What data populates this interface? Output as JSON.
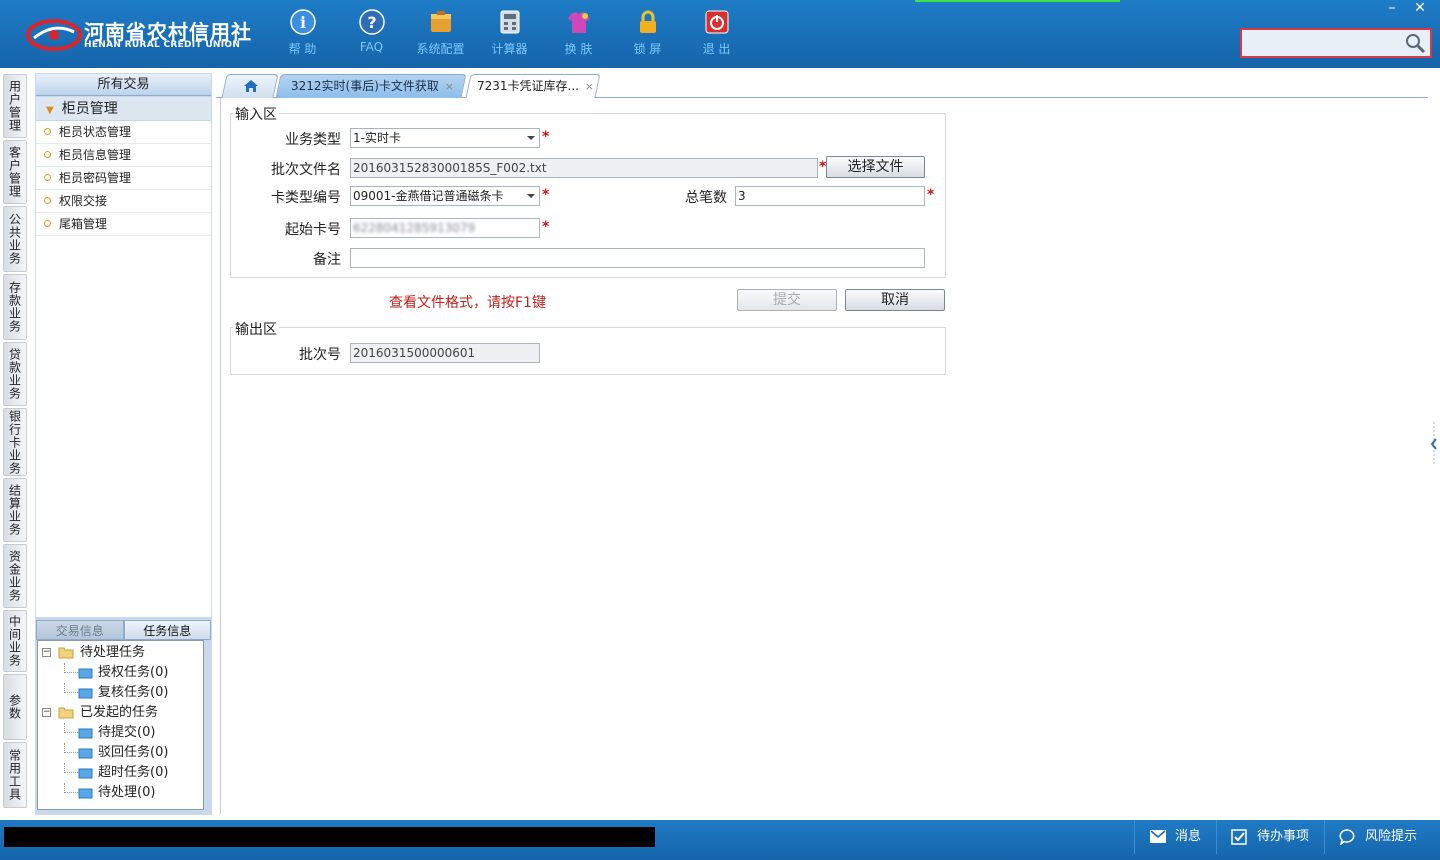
{
  "header": {
    "logo_cn": "河南省农村信用社",
    "logo_en": "HENAN RURAL CREDIT UNION",
    "toolbar": [
      {
        "label": "帮 助",
        "icon": "help-icon"
      },
      {
        "label": "FAQ",
        "icon": "faq-icon"
      },
      {
        "label": "系统配置",
        "icon": "system-config-icon"
      },
      {
        "label": "计算器",
        "icon": "calculator-icon"
      },
      {
        "label": "换 肤",
        "icon": "skin-icon"
      },
      {
        "label": "锁 屏",
        "icon": "lock-icon"
      },
      {
        "label": "退 出",
        "icon": "power-icon"
      }
    ],
    "window_buttons": {
      "minimize": "–",
      "close": "✕"
    },
    "search": {
      "value": ""
    }
  },
  "side_tabs": [
    "用户管理",
    "客户管理",
    "公共业务",
    "存款业务",
    "贷款业务",
    "银行卡业务",
    "结算业务",
    "资金业务",
    "中间业务",
    "参数",
    "常用工具"
  ],
  "left_panel": {
    "title": "所有交易",
    "group": "柜员管理",
    "items": [
      "柜员状态管理",
      "柜员信息管理",
      "柜员密码管理",
      "权限交接",
      "尾箱管理"
    ],
    "tabs": {
      "trans_info": "交易信息",
      "task_info": "任务信息"
    },
    "tree": {
      "pending": "待处理任务",
      "pending_children": [
        "授权任务(0)",
        "复核任务(0)"
      ],
      "initiated": "已发起的任务",
      "initiated_children": [
        "待提交(0)",
        "驳回任务(0)",
        "超时任务(0)",
        "待处理(0)"
      ]
    }
  },
  "content_tabs": {
    "active": "3212实时(事后)卡文件获取",
    "second": "7231卡凭证库存...",
    "close": "×"
  },
  "form": {
    "input_section": "输入区",
    "business_type_label": "业务类型",
    "business_type_value": "1-实时卡",
    "batch_file_label": "批次文件名",
    "batch_file_value": "20160315283000185S_F002.txt",
    "choose_file_button": "选择文件",
    "card_type_label": "卡类型编号",
    "card_type_value": "09001-金燕借记普通磁条卡",
    "total_count_label": "总笔数",
    "total_count_value": "3",
    "start_card_label": "起始卡号",
    "start_card_value": "6228041285913079",
    "remark_label": "备注",
    "remark_value": "",
    "required_mark": "*",
    "hint": "查看文件格式，请按F1键",
    "submit_button": "提交",
    "cancel_button": "取消",
    "output_section": "输出区",
    "batch_no_label": "批次号",
    "batch_no_value": "2016031500000601"
  },
  "statusbar": {
    "messages": "消息",
    "todo": "待办事项",
    "risk": "风险提示"
  },
  "colors": {
    "header_blue": "#1a6fb8",
    "required_red": "#d01010",
    "hint_red": "#c0201a"
  }
}
